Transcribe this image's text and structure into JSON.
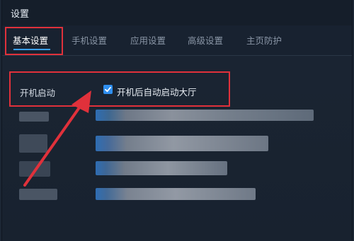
{
  "window": {
    "title": "设置"
  },
  "tabs": [
    {
      "label": "基本设置",
      "active": true
    },
    {
      "label": "手机设置",
      "active": false
    },
    {
      "label": "应用设置",
      "active": false
    },
    {
      "label": "高级设置",
      "active": false
    },
    {
      "label": "主页防护",
      "active": false
    }
  ],
  "startup": {
    "label": "开机启动",
    "checkbox_label": "开机后自动启动大厅",
    "checked": true
  },
  "colors": {
    "accent": "#3aa0ff",
    "highlight": "#e0313b",
    "background": "#1c2634"
  },
  "icons": [
    "check-icon",
    "red-arrow-annotation"
  ]
}
